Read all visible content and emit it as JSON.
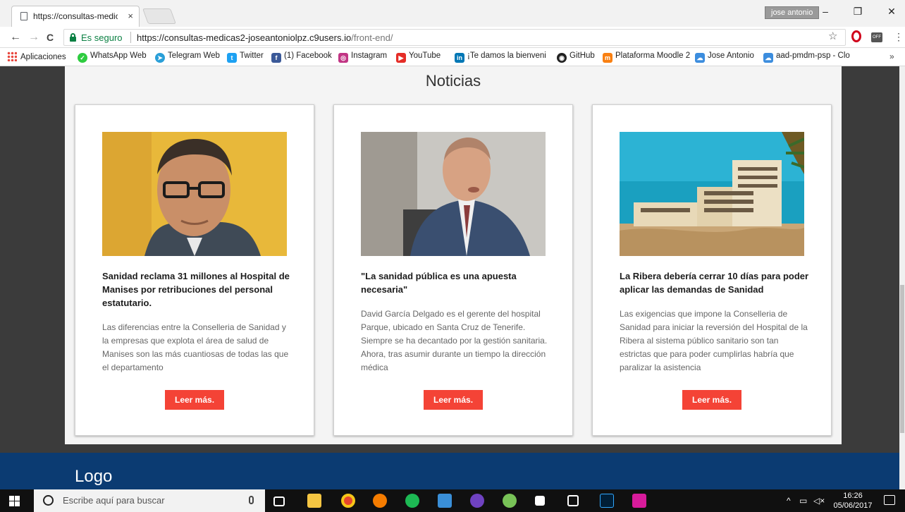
{
  "browser": {
    "tab_title": "https://consultas-medica",
    "tab_close": "×",
    "user_badge": "jose antonio",
    "win_min": "–",
    "win_max": "❐",
    "win_close": "✕",
    "back": "←",
    "forward": "→",
    "reload": "C",
    "secure_label": "Es seguro",
    "url_host": "https://consultas-medicas2-joseantoniolpz.c9users.io",
    "url_path": "/front-end/",
    "star": "☆",
    "ext_off_label": "OFF",
    "menu_dots": "⋮"
  },
  "bookmarks": {
    "apps_label": "Aplicaciones",
    "items": [
      {
        "label": "WhatsApp Web",
        "icon": "whatsapp-icon",
        "color": "#2ecc40",
        "glyph": "●"
      },
      {
        "label": "Telegram Web",
        "icon": "telegram-icon",
        "color": "#2a9fd8",
        "glyph": "➤"
      },
      {
        "label": "Twitter",
        "icon": "twitter-icon",
        "color": "#1da1f2",
        "glyph": "t"
      },
      {
        "label": "(1) Facebook",
        "icon": "facebook-icon",
        "color": "#3b5998",
        "glyph": "f"
      },
      {
        "label": "Instagram",
        "icon": "instagram-icon",
        "color": "#c13584",
        "glyph": "◎"
      },
      {
        "label": "YouTube",
        "icon": "youtube-icon",
        "color": "#e52d27",
        "glyph": "▶"
      },
      {
        "label": "¡Te damos la bienveni",
        "icon": "linkedin-icon",
        "color": "#0077b5",
        "glyph": "in"
      },
      {
        "label": "GitHub",
        "icon": "github-icon",
        "color": "#222222",
        "glyph": "◉"
      },
      {
        "label": "Plataforma Moodle 2",
        "icon": "moodle-icon",
        "color": "#f98012",
        "glyph": "m"
      },
      {
        "label": "Jose Antonio",
        "icon": "cloud-icon",
        "color": "#3c8dde",
        "glyph": "☁"
      },
      {
        "label": "aad-pmdm-psp - Clo",
        "icon": "cloud-icon",
        "color": "#3c8dde",
        "glyph": "☁"
      }
    ],
    "more": "»"
  },
  "page": {
    "title": "Noticias",
    "cards": [
      {
        "headline": "Sanidad reclama 31 millones al Hospital de Manises por retribuciones del personal estatutario.",
        "summary": "Las diferencias entre la Conselleria de Sanidad y la empresas que explota el área de salud de Manises son las más cuantiosas de todas las que el departamento",
        "button": "Leer más."
      },
      {
        "headline": "\"La sanidad pública es una apuesta necesaria\"",
        "summary": "David García Delgado es el gerente del hospital Parque, ubicado en Santa Cruz de Tenerife. Siempre se ha decantado por la gestión sanitaria. Ahora, tras asumir durante un tiempo la dirección médica",
        "button": "Leer más."
      },
      {
        "headline": "La Ribera debería cerrar 10 días para poder aplicar las demandas de Sanidad",
        "summary": "Las exigencias que impone la Conselleria de Sanidad para iniciar la reversión del Hospital de la Ribera al sistema público sanitario son tan estrictas que para poder cumplirlas habría que paralizar la asistencia",
        "button": "Leer más."
      }
    ],
    "footer_logo": "Logo"
  },
  "taskbar": {
    "search_placeholder": "Escribe aquí para buscar",
    "time": "16:26",
    "date": "05/06/2017"
  }
}
